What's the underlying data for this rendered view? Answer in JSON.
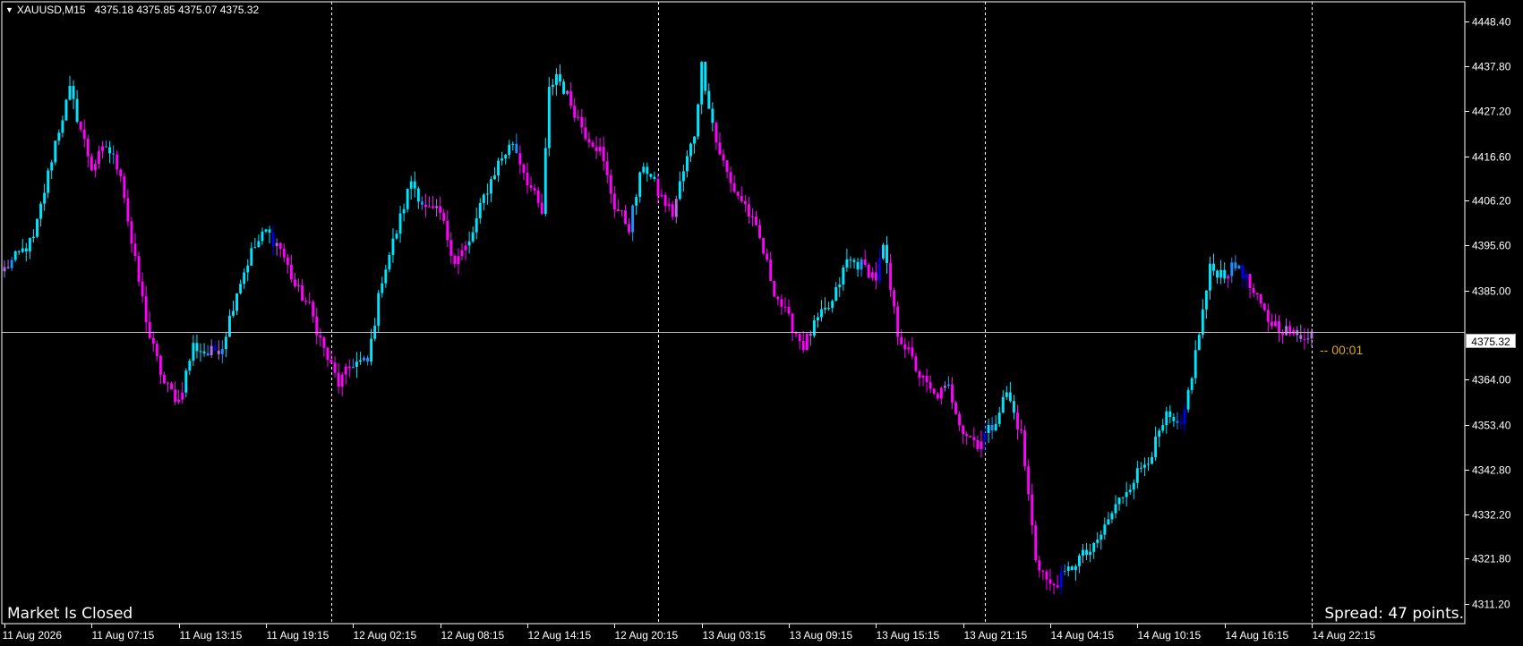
{
  "window": {
    "symbol_timeframe": "XAUUSD,M15",
    "ohlc": "4375.18 4375.85 4375.07 4375.32",
    "market_status": "Market Is Closed",
    "spread": "Spread: 47 points.",
    "countdown": "-- 00:01",
    "current_price": "4375.32"
  },
  "colors": {
    "background": "#000000",
    "axis": "#FFFFFF",
    "grid_separator": "#FFFFFF",
    "bid_line": "#C0C0C0",
    "bull": "#00E5FF",
    "bull_mid": "#1E90FF",
    "bull_weak": "#0000EE",
    "bear": "#FF00FF",
    "bear_weak": "#B070E0",
    "countdown": "#DAA520"
  },
  "chart_data": {
    "type": "candlestick",
    "ylim": [
      4306.5,
      4453.0
    ],
    "y_ticks": [
      "4448.40",
      "4437.80",
      "4427.20",
      "4416.60",
      "4406.20",
      "4395.60",
      "4385.00",
      "4364.00",
      "4353.40",
      "4342.80",
      "4332.20",
      "4321.80",
      "4311.20"
    ],
    "x_ticks": [
      "11 Aug 2026",
      "11 Aug 07:15",
      "11 Aug 13:15",
      "11 Aug 19:15",
      "12 Aug 02:15",
      "12 Aug 08:15",
      "12 Aug 14:15",
      "12 Aug 20:15",
      "13 Aug 03:15",
      "13 Aug 09:15",
      "13 Aug 15:15",
      "13 Aug 21:15",
      "14 Aug 04:15",
      "14 Aug 10:15",
      "14 Aug 16:15",
      "14 Aug 22:15"
    ],
    "separator_bars": [
      90,
      180,
      270,
      360
    ],
    "bid_price": 4375.32,
    "close_path": [
      [
        0,
        4390
      ],
      [
        8,
        4397
      ],
      [
        14,
        4420
      ],
      [
        18,
        4432
      ],
      [
        24,
        4414
      ],
      [
        28,
        4419
      ],
      [
        32,
        4413
      ],
      [
        35,
        4396
      ],
      [
        40,
        4374
      ],
      [
        44,
        4363
      ],
      [
        48,
        4359
      ],
      [
        52,
        4372
      ],
      [
        56,
        4370
      ],
      [
        60,
        4372
      ],
      [
        64,
        4385
      ],
      [
        68,
        4394
      ],
      [
        72,
        4399
      ],
      [
        76,
        4395
      ],
      [
        80,
        4386
      ],
      [
        84,
        4381
      ],
      [
        88,
        4371
      ],
      [
        92,
        4363
      ],
      [
        96,
        4368
      ],
      [
        100,
        4368
      ],
      [
        104,
        4388
      ],
      [
        108,
        4399
      ],
      [
        112,
        4411
      ],
      [
        116,
        4404
      ],
      [
        120,
        4403
      ],
      [
        124,
        4392
      ],
      [
        128,
        4396
      ],
      [
        132,
        4407
      ],
      [
        136,
        4415
      ],
      [
        140,
        4420
      ],
      [
        144,
        4411
      ],
      [
        148,
        4403
      ],
      [
        150,
        4432
      ],
      [
        152,
        4436
      ],
      [
        156,
        4429
      ],
      [
        160,
        4422
      ],
      [
        164,
        4418
      ],
      [
        168,
        4405
      ],
      [
        172,
        4400
      ],
      [
        176,
        4415
      ],
      [
        180,
        4408
      ],
      [
        184,
        4403
      ],
      [
        186,
        4410
      ],
      [
        190,
        4422
      ],
      [
        192,
        4438
      ],
      [
        196,
        4420
      ],
      [
        200,
        4410
      ],
      [
        204,
        4405
      ],
      [
        208,
        4397
      ],
      [
        212,
        4385
      ],
      [
        216,
        4378
      ],
      [
        220,
        4372
      ],
      [
        224,
        4378
      ],
      [
        228,
        4382
      ],
      [
        232,
        4392
      ],
      [
        236,
        4391
      ],
      [
        240,
        4388
      ],
      [
        242,
        4395
      ],
      [
        244,
        4385
      ],
      [
        246,
        4375
      ],
      [
        248,
        4372
      ],
      [
        252,
        4365
      ],
      [
        256,
        4360
      ],
      [
        260,
        4362
      ],
      [
        264,
        4352
      ],
      [
        268,
        4349
      ],
      [
        272,
        4353
      ],
      [
        276,
        4361
      ],
      [
        280,
        4351
      ],
      [
        284,
        4322
      ],
      [
        288,
        4315
      ],
      [
        292,
        4318
      ],
      [
        296,
        4322
      ],
      [
        300,
        4324
      ],
      [
        304,
        4331
      ],
      [
        308,
        4337
      ],
      [
        312,
        4342
      ],
      [
        316,
        4347
      ],
      [
        320,
        4355
      ],
      [
        324,
        4352
      ],
      [
        328,
        4370
      ],
      [
        332,
        4390
      ],
      [
        336,
        4389
      ],
      [
        340,
        4391
      ],
      [
        344,
        4384
      ],
      [
        348,
        4378
      ],
      [
        352,
        4376
      ],
      [
        356,
        4374
      ],
      [
        360,
        4375.32
      ]
    ]
  }
}
